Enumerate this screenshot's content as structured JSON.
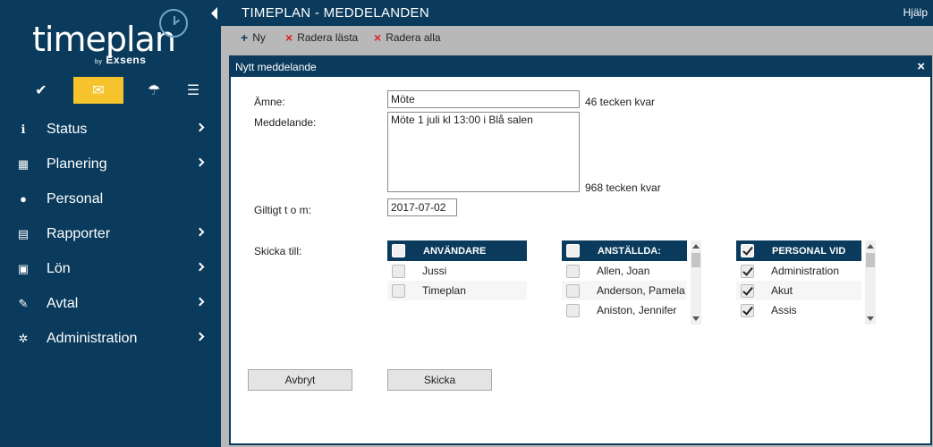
{
  "brand": {
    "name": "timeplan",
    "by": "by",
    "sub": "Exsens"
  },
  "quick_icons": [
    {
      "icon": "check-icon",
      "glyph": "✔"
    },
    {
      "icon": "mail-icon",
      "glyph": "✉"
    },
    {
      "icon": "umbrella-icon",
      "glyph": "☂"
    },
    {
      "icon": "list-icon",
      "glyph": "☰"
    }
  ],
  "nav": [
    {
      "label": "Status",
      "icon": "info-icon",
      "glyph": "ℹ",
      "chevron": true
    },
    {
      "label": "Planering",
      "icon": "calendar-icon",
      "glyph": "▦",
      "chevron": true
    },
    {
      "label": "Personal",
      "icon": "person-icon",
      "glyph": "●",
      "chevron": false
    },
    {
      "label": "Rapporter",
      "icon": "document-icon",
      "glyph": "▤",
      "chevron": true
    },
    {
      "label": "Lön",
      "icon": "money-icon",
      "glyph": "▣",
      "chevron": true
    },
    {
      "label": "Avtal",
      "icon": "wrench-icon",
      "glyph": "✎",
      "chevron": true
    },
    {
      "label": "Administration",
      "icon": "gears-icon",
      "glyph": "✲",
      "chevron": true
    }
  ],
  "topbar": {
    "title": "TIMEPLAN - MEDDELANDEN",
    "help": "Hjälp"
  },
  "toolbar": {
    "new": "Ny",
    "delete_read": "Radera lästa",
    "delete_all": "Radera alla"
  },
  "dialog": {
    "title": "Nytt meddelande",
    "close": "×",
    "subject_label": "Ämne:",
    "subject_value": "Möte",
    "subject_hint": "46 tecken kvar",
    "message_label": "Meddelande:",
    "message_value": "Möte 1 juli kl 13:00 i Blå salen",
    "message_hint": "968 tecken kvar",
    "valid_label": "Giltigt t o m:",
    "valid_value": "2017-07-02",
    "send_to_label": "Skicka till:",
    "cancel": "Avbryt",
    "send": "Skicka"
  },
  "lists": {
    "users": {
      "header": "ANVÄNDARE",
      "header_checked": false,
      "rows": [
        {
          "label": "Jussi",
          "checked": false
        },
        {
          "label": "Timeplan",
          "checked": false
        }
      ]
    },
    "employees": {
      "header": "ANSTÄLLDA:",
      "header_checked": false,
      "rows": [
        {
          "label": "Allen, Joan",
          "checked": false
        },
        {
          "label": "Anderson, Pamela",
          "checked": false
        },
        {
          "label": "Aniston, Jennifer",
          "checked": false
        }
      ]
    },
    "staff_at": {
      "header": "PERSONAL VID",
      "header_checked": true,
      "rows": [
        {
          "label": "Administration",
          "checked": true
        },
        {
          "label": "Akut",
          "checked": true
        },
        {
          "label": "Assis",
          "checked": true
        }
      ]
    }
  }
}
